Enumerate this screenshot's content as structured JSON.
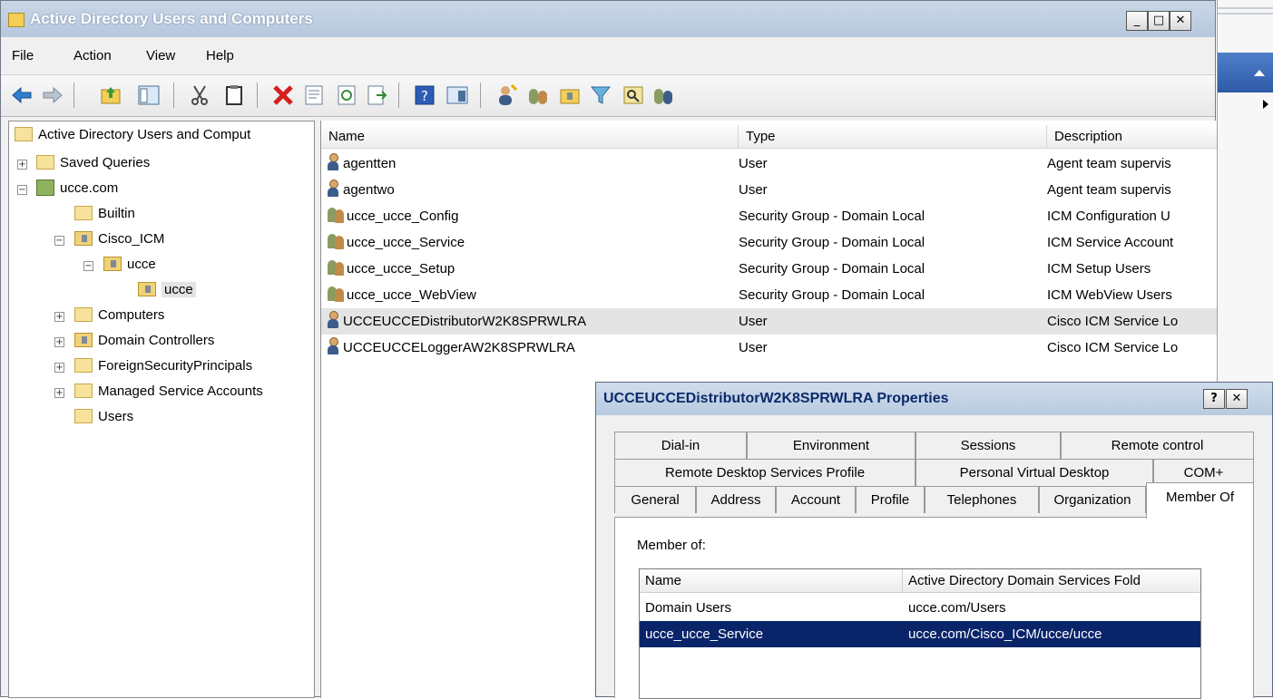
{
  "window": {
    "title": "Active Directory Users and Computers",
    "minimize": "_",
    "maximize": "□",
    "close": "✕"
  },
  "menu": [
    "File",
    "Action",
    "View",
    "Help"
  ],
  "toolbar_icons": [
    "back-arrow-icon",
    "forward-arrow-icon",
    "up-folder-icon",
    "show-console-tree-icon",
    "cut-icon",
    "copy-icon",
    "delete-icon",
    "properties-icon",
    "refresh-icon",
    "export-list-icon",
    "help-icon",
    "console-view-icon",
    "new-user-icon",
    "new-group-icon",
    "new-ou-icon",
    "filter-icon",
    "find-icon",
    "add-to-group-icon"
  ],
  "tree": {
    "root": "Active Directory Users and Comput",
    "items": [
      {
        "label": "Saved Queries",
        "expander": "+"
      },
      {
        "label": "ucce.com",
        "expander": "−"
      },
      {
        "label": "Builtin"
      },
      {
        "label": "Cisco_ICM",
        "expander": "−"
      },
      {
        "label": "ucce",
        "expander": "−"
      },
      {
        "label": "ucce"
      },
      {
        "label": "Computers",
        "expander": "+"
      },
      {
        "label": "Domain Controllers",
        "expander": "+"
      },
      {
        "label": "ForeignSecurityPrincipals",
        "expander": "+"
      },
      {
        "label": "Managed Service Accounts",
        "expander": "+"
      },
      {
        "label": "Users"
      }
    ]
  },
  "list": {
    "columns": [
      "Name",
      "Type",
      "Description"
    ],
    "rows": [
      {
        "name": "agentten",
        "type": "User",
        "description": "Agent team supervis",
        "icon": "user"
      },
      {
        "name": "agentwo",
        "type": "User",
        "description": "Agent team supervis",
        "icon": "user"
      },
      {
        "name": "ucce_ucce_Config",
        "type": "Security Group - Domain Local",
        "description": "ICM Configuration U",
        "icon": "group"
      },
      {
        "name": "ucce_ucce_Service",
        "type": "Security Group - Domain Local",
        "description": "ICM Service Account",
        "icon": "group"
      },
      {
        "name": "ucce_ucce_Setup",
        "type": "Security Group - Domain Local",
        "description": "ICM Setup Users",
        "icon": "group"
      },
      {
        "name": "ucce_ucce_WebView",
        "type": "Security Group - Domain Local",
        "description": "ICM WebView Users",
        "icon": "group"
      },
      {
        "name": "UCCEUCCEDistributorW2K8SPRWLRA",
        "type": "User",
        "description": "Cisco ICM Service Lo",
        "icon": "user"
      },
      {
        "name": "UCCEUCCELoggerAW2K8SPRWLRA",
        "type": "User",
        "description": "Cisco ICM Service Lo",
        "icon": "user"
      }
    ]
  },
  "dialog": {
    "title": "UCCEUCCEDistributorW2K8SPRWLRA Properties",
    "help": "?",
    "close": "✕",
    "tabs_row1": [
      "Dial-in",
      "Environment",
      "Sessions",
      "Remote control"
    ],
    "tabs_row2": [
      "Remote Desktop Services Profile",
      "Personal Virtual Desktop",
      "COM+"
    ],
    "tabs_row3": [
      "General",
      "Address",
      "Account",
      "Profile",
      "Telephones",
      "Organization",
      "Member Of"
    ],
    "member_of_label": "Member of:",
    "member_columns": [
      "Name",
      "Active Directory Domain Services Fold"
    ],
    "members": [
      {
        "name": "Domain Users",
        "folder": "ucce.com/Users"
      },
      {
        "name": "ucce_ucce_Service",
        "folder": "ucce.com/Cisco_ICM/ucce/ucce"
      }
    ]
  }
}
